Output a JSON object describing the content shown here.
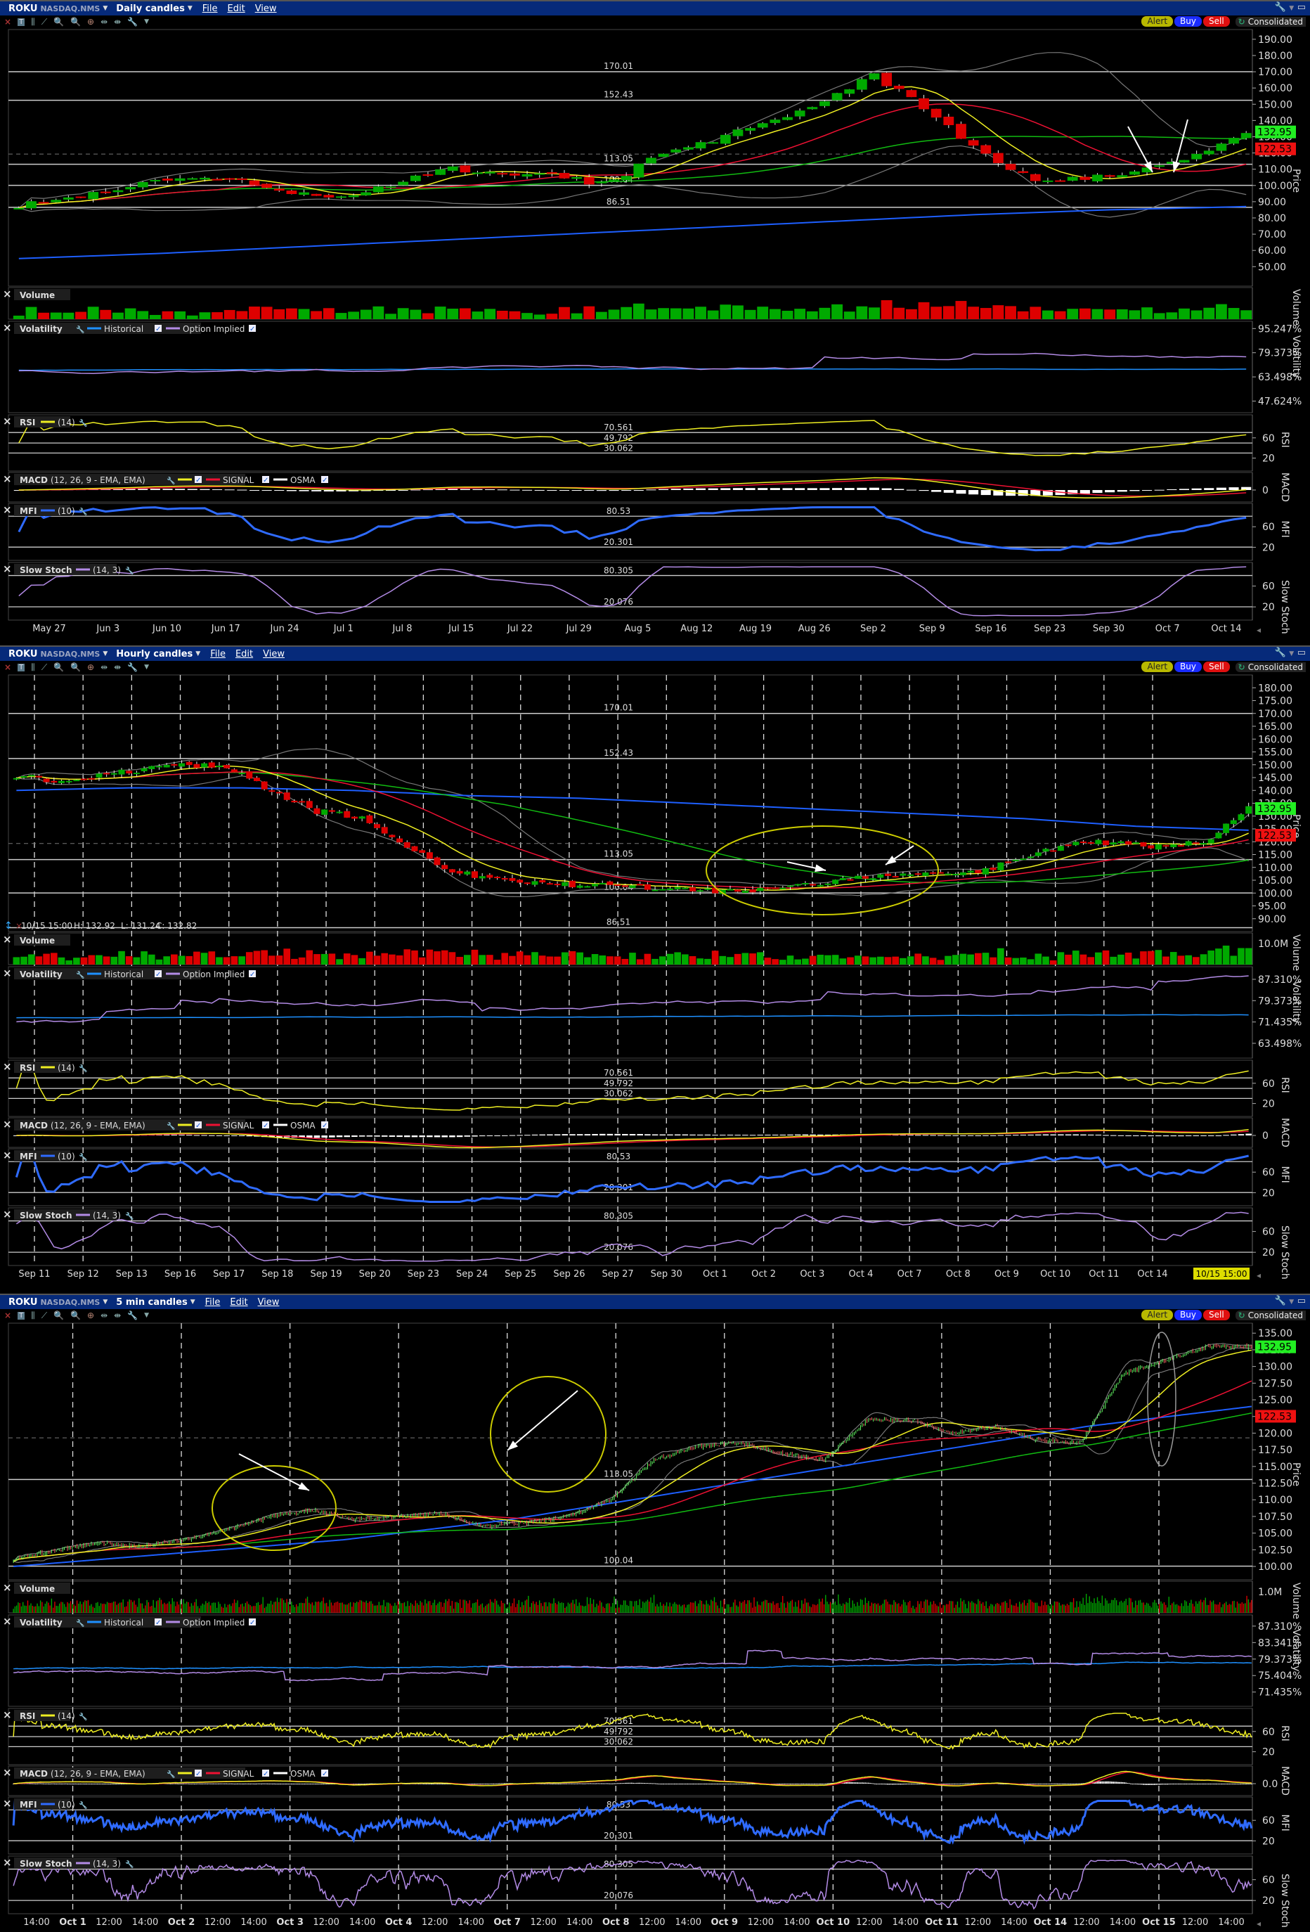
{
  "symbol": "ROKU",
  "exchange": "NASDAQ.NMS",
  "menu": {
    "file": "File",
    "edit": "Edit",
    "view": "View"
  },
  "buttons": {
    "alert": "Alert",
    "buy": "Buy",
    "sell": "Sell",
    "consolidated": "Consolidated"
  },
  "price_tags": {
    "last": "132.95",
    "other": "122.53",
    "last_color": "#22ee22",
    "other_color": "#ee1111"
  },
  "indicators": {
    "volume": {
      "label": "Volume",
      "axis": "Volume"
    },
    "volatility": {
      "label": "Volatility",
      "historical": "Historical",
      "implied": "Option Implied",
      "axis": "Volatility"
    },
    "rsi": {
      "label": "RSI",
      "params": "(14)",
      "axis": "RSI",
      "levels": [
        "70.561",
        "49.792",
        "30.062"
      ]
    },
    "macd": {
      "label": "MACD",
      "params": "(12, 26, 9 - EMA, EMA)",
      "signal": "SIGNAL",
      "osma": "OSMA",
      "axis": "MACD"
    },
    "mfi": {
      "label": "MFI",
      "params": "(10)",
      "axis": "MFI",
      "levels": [
        "80.53",
        "20.301"
      ]
    },
    "stoch": {
      "label": "Slow Stoch",
      "params": "(14, 3)",
      "axis": "Slow Stoch",
      "levels": [
        "80.305",
        "20.076"
      ]
    }
  },
  "price_axis_label": "Price",
  "colors": {
    "up": "#00aa00",
    "down": "#dd0000",
    "sma_fast": "#eeee22",
    "sma_mid": "#ee1133",
    "sma_slow": "#11bb11",
    "sma_long": "#1e5fff",
    "bands": "#777777",
    "hist_vol": "#1e90ff",
    "impl_vol": "#b38be6",
    "mfi": "#2f6bff",
    "stoch": "#b38be6"
  },
  "panels": [
    {
      "timeframe": "Daily candles",
      "bars": 100,
      "closes": [
        88,
        92,
        100,
        103,
        104,
        95,
        93,
        100,
        111,
        108,
        107,
        100,
        120,
        128,
        138,
        150,
        168,
        148,
        120,
        103,
        104,
        108,
        118,
        132.95
      ],
      "price_range": [
        38,
        196
      ],
      "price_ticks": [
        "190.00",
        "180.00",
        "170.00",
        "160.00",
        "150.00",
        "140.00",
        "130.00",
        "120.00",
        "110.00",
        "100.00",
        "90.00",
        "80.00",
        "70.00",
        "60.00",
        "50.00"
      ],
      "levels": [
        "170.01",
        "152.43",
        "113.05",
        "100.04",
        "86.51"
      ],
      "long_ma": [
        55,
        58,
        62,
        66,
        70,
        74,
        78,
        82,
        85,
        87
      ],
      "volume_tick": "",
      "vol_range": [
        40,
        100
      ],
      "vol_ticks": [
        "95.247%",
        "79.373%",
        "63.498%",
        "47.624%"
      ],
      "rsi_ticks": [
        "60",
        "20"
      ],
      "macd_tick": "0",
      "mfi_ticks": [
        "60",
        "20"
      ],
      "stoch_ticks": [
        "60",
        "20"
      ],
      "x_labels": [
        "May 27",
        "Jun 3",
        "Jun 10",
        "Jun 17",
        "Jun 24",
        "Jul 1",
        "Jul 8",
        "Jul 15",
        "Jul 22",
        "Jul 29",
        "Aug 5",
        "Aug 12",
        "Aug 19",
        "Aug 26",
        "Sep 2",
        "Sep 9",
        "Sep 16",
        "Sep 23",
        "Sep 30",
        "Oct 7",
        "Oct 14"
      ],
      "dashed": false
    },
    {
      "timeframe": "Hourly candles",
      "bars": 165,
      "closes": [
        146,
        143,
        146,
        148,
        150,
        149,
        140,
        132,
        130,
        120,
        110,
        106,
        104,
        103,
        104,
        102,
        101,
        101,
        102,
        104,
        106,
        108,
        107,
        110,
        116,
        120,
        119,
        118,
        120,
        132.95
      ],
      "price_range": [
        85,
        185
      ],
      "price_ticks": [
        "180.00",
        "175.00",
        "170.00",
        "165.00",
        "160.00",
        "155.00",
        "150.00",
        "145.00",
        "140.00",
        "135.00",
        "130.00",
        "125.00",
        "120.00",
        "115.00",
        "110.00",
        "105.00",
        "100.00",
        "95.00",
        "90.00"
      ],
      "levels": [
        "170.01",
        "152.43",
        "113.05",
        "100.04",
        "86.51"
      ],
      "long_ma": [
        140,
        141,
        141,
        140,
        138,
        137,
        135,
        133,
        131,
        129,
        126,
        124.5
      ],
      "readout": {
        "time": "10/15 15:00",
        "high": "H: 132.92",
        "low": "L: 131.24",
        "close": "C: 132.82"
      },
      "volume_tick": "10.0M",
      "vol_range": [
        58,
        92
      ],
      "vol_ticks": [
        "87.310%",
        "79.373%",
        "71.435%",
        "63.498%"
      ],
      "rsi_ticks": [
        "60",
        "20"
      ],
      "macd_tick": "0",
      "mfi_ticks": [
        "60",
        "20"
      ],
      "stoch_ticks": [
        "60",
        "20"
      ],
      "x_labels": [
        "Sep 11",
        "Sep 12",
        "Sep 13",
        "Sep 16",
        "Sep 17",
        "Sep 18",
        "Sep 19",
        "Sep 20",
        "Sep 23",
        "Sep 24",
        "Sep 25",
        "Sep 26",
        "Sep 27",
        "Sep 30",
        "Oct 1",
        "Oct 2",
        "Oct 3",
        "Oct 4",
        "Oct 7",
        "Oct 8",
        "Oct 9",
        "Oct 10",
        "Oct 11",
        "Oct 14"
      ],
      "current_label": "10/15 15:00",
      "dashed": true
    },
    {
      "timeframe": "5 min candles",
      "bars": 780,
      "closes": [
        101,
        102.5,
        103.5,
        103,
        104,
        105.5,
        107.5,
        108.5,
        107,
        107.5,
        108,
        106,
        106.5,
        107.5,
        110,
        116,
        118,
        118.5,
        117,
        116,
        122,
        122,
        120,
        121,
        119,
        118.5,
        129,
        131,
        133,
        132.95
      ],
      "price_range": [
        98,
        136.5
      ],
      "price_ticks": [
        "135.00",
        "132.50",
        "130.00",
        "127.50",
        "125.00",
        "122.50",
        "120.00",
        "117.50",
        "115.00",
        "112.50",
        "110.00",
        "107.50",
        "105.00",
        "102.50",
        "100.00"
      ],
      "levels": [
        "113.05",
        "100.04"
      ],
      "long_ma": [
        100,
        101,
        102,
        103,
        104,
        105.5,
        107,
        109,
        111,
        113,
        115,
        117,
        119,
        121,
        122.5,
        124
      ],
      "volume_tick": "1.0M",
      "vol_range": [
        68,
        90
      ],
      "vol_ticks": [
        "87.310%",
        "83.341%",
        "79.373%",
        "75.404%",
        "71.435%"
      ],
      "rsi_ticks": [
        "60",
        "20"
      ],
      "macd_tick": "0.0",
      "mfi_ticks": [
        "60",
        "20"
      ],
      "stoch_ticks": [
        "60",
        "20"
      ],
      "x_labels": [
        "14:00",
        "Oct 1",
        "12:00",
        "14:00",
        "Oct 2",
        "12:00",
        "14:00",
        "Oct 3",
        "12:00",
        "14:00",
        "Oct 4",
        "12:00",
        "14:00",
        "Oct 7",
        "12:00",
        "14:00",
        "Oct 8",
        "12:00",
        "14:00",
        "Oct 9",
        "12:00",
        "14:00",
        "Oct 10",
        "12:00",
        "14:00",
        "Oct 11",
        "12:00",
        "14:00",
        "Oct 14",
        "12:00",
        "14:00",
        "Oct 15",
        "12:00",
        "14:00"
      ],
      "dashed": true
    }
  ]
}
